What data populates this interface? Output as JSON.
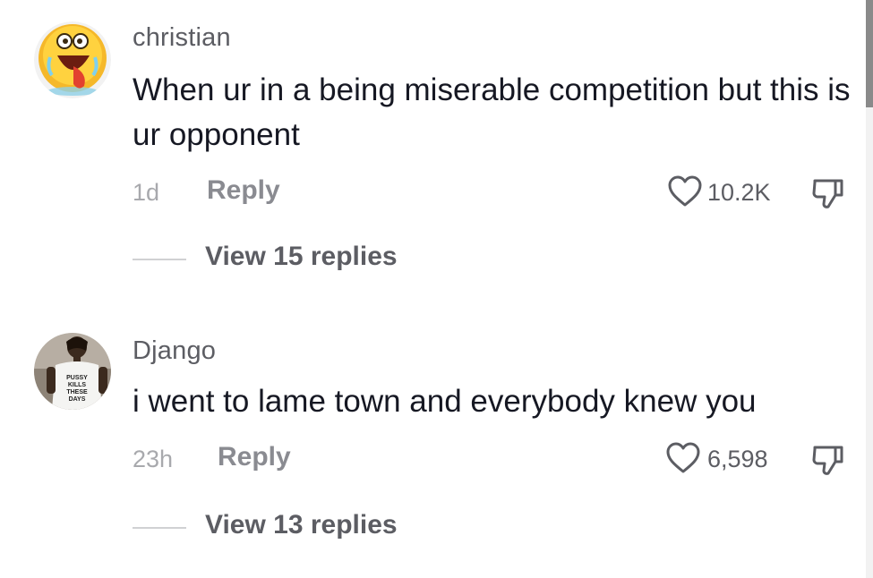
{
  "comments": [
    {
      "username": "christian",
      "text": "When ur in a being miserable competition but this is ur opponent",
      "time": "1d",
      "reply_label": "Reply",
      "likes": "10.2K",
      "view_replies": "View 15 replies",
      "avatar_icon": "laughing-emoji-avatar"
    },
    {
      "username": "Django",
      "text": "i went to lame town and everybody knew you",
      "time": "23h",
      "reply_label": "Reply",
      "likes": "6,598",
      "view_replies": "View 13 replies",
      "avatar_icon": "person-photo-avatar"
    }
  ],
  "colors": {
    "username": "#5c5d63",
    "body_text": "#161823",
    "muted": "#a8a9ad",
    "reply": "#8a8b91"
  }
}
